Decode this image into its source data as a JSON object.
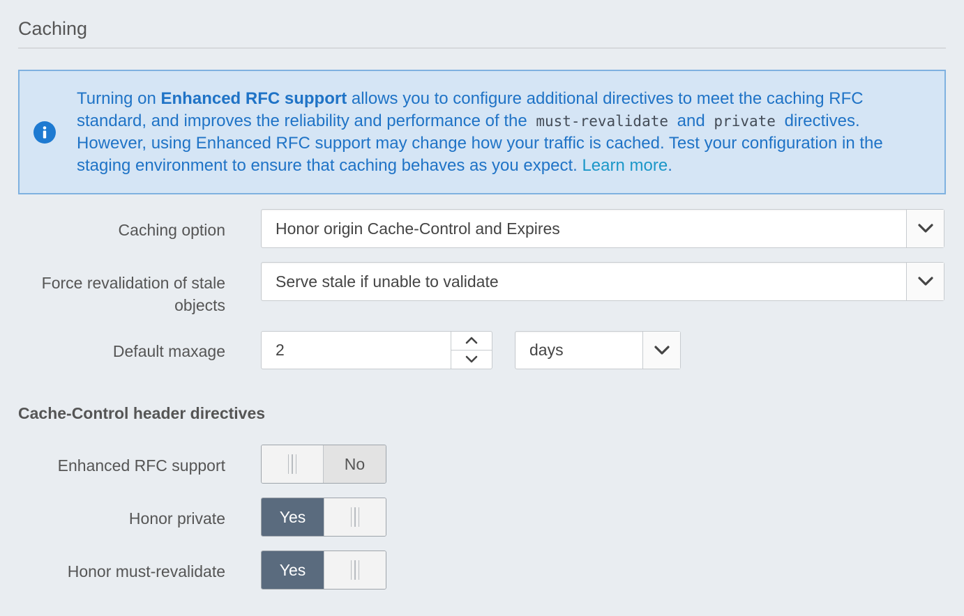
{
  "section": {
    "title": "Caching"
  },
  "info": {
    "icon": "info-circle-icon",
    "text_1": "Turning on ",
    "bold": "Enhanced RFC support",
    "text_2": " allows you to configure additional directives to meet the caching RFC standard, and improves the reliability and performance of the ",
    "code_1": "must-revalidate",
    "text_3": " and ",
    "code_2": "private",
    "text_4": " directives. However, using Enhanced RFC support may change how your traffic is cached. Test your configuration in the staging environment to ensure that caching behaves as you expect. ",
    "link": "Learn more",
    "text_5": "."
  },
  "fields": {
    "caching_option": {
      "label": "Caching option",
      "value": "Honor origin Cache-Control and Expires"
    },
    "force_revalidation": {
      "label": "Force revalidation of stale objects",
      "value": "Serve stale if unable to validate"
    },
    "default_maxage": {
      "label": "Default maxage",
      "value": "2",
      "unit": "days"
    }
  },
  "directives": {
    "heading": "Cache-Control header directives",
    "enhanced_rfc": {
      "label": "Enhanced RFC support",
      "state": "No"
    },
    "honor_private": {
      "label": "Honor private",
      "state": "Yes"
    },
    "honor_must_revalidate": {
      "label": "Honor must-revalidate",
      "state": "Yes"
    }
  },
  "colors": {
    "accent": "#1f73c6",
    "toggle_on": "#5a6b7e",
    "info_bg": "#d5e5f5"
  }
}
